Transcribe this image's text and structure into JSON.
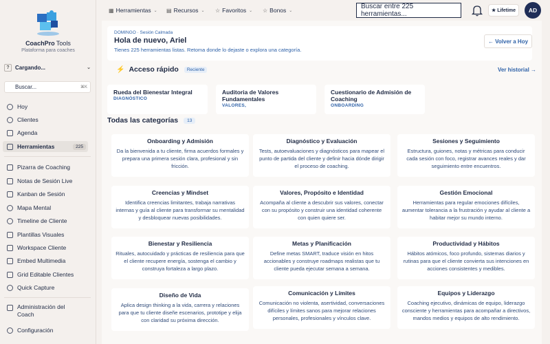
{
  "brand": {
    "name_bold": "CoachPro",
    "name_light": " Tools",
    "tagline": "Plataforma para coaches"
  },
  "account": {
    "avatar_letter": "?",
    "label": "Cargando..."
  },
  "sidebar_search": {
    "placeholder": "Buscar...",
    "shortcut": "⌘K"
  },
  "sidebar": {
    "primary": [
      {
        "label": "Hoy",
        "icon": "sun-icon"
      },
      {
        "label": "Clientes",
        "icon": "users-icon"
      },
      {
        "label": "Agenda",
        "icon": "calendar-icon"
      },
      {
        "label": "Herramientas",
        "icon": "grid-icon",
        "count": "225",
        "active": true
      }
    ],
    "tools": [
      {
        "label": "Pizarra de Coaching",
        "icon": "whiteboard-icon"
      },
      {
        "label": "Notas de Sesión Live",
        "icon": "notes-icon"
      },
      {
        "label": "Kanban de Sesión",
        "icon": "kanban-icon"
      },
      {
        "label": "Mapa Mental",
        "icon": "mindmap-icon"
      },
      {
        "label": "Timeline de Cliente",
        "icon": "timeline-icon"
      },
      {
        "label": "Plantillas Visuales",
        "icon": "template-icon"
      },
      {
        "label": "Workspace Cliente",
        "icon": "workspace-icon"
      },
      {
        "label": "Embed Multimedia",
        "icon": "video-icon"
      },
      {
        "label": "Grid Editable Clientes",
        "icon": "table-icon"
      },
      {
        "label": "Quick Capture",
        "icon": "lightning-icon"
      }
    ],
    "bottom": [
      {
        "label": "Administración del Coach",
        "icon": "shield-icon"
      },
      {
        "label": "Configuración",
        "icon": "gear-icon"
      }
    ]
  },
  "topbar": {
    "menus": [
      {
        "label": "Herramientas",
        "icon": "grid-icon"
      },
      {
        "label": "Recursos",
        "icon": "book-icon"
      },
      {
        "label": "Favoritos",
        "icon": "star-icon"
      },
      {
        "label": "Bonos",
        "icon": "gift-icon"
      }
    ],
    "search_placeholder": "Buscar entre 225 herramientas...",
    "lifetime_label": "★ Lifetime",
    "avatar_initials": "AD"
  },
  "hero": {
    "kicker": "DOMINGO · Sesión Calmada",
    "greeting": "Hola de nuevo, Ariel",
    "subtitle": "Tienes 225 herramientas listas. Retoma donde lo dejaste o explora una categoría.",
    "back_button": "← Volver a Hoy"
  },
  "quick_access": {
    "title": "Acceso rápido",
    "badge": "Reciente",
    "history_link": "Ver historial →",
    "cards": [
      {
        "title": "Rueda del Bienestar Integral",
        "category": "DIAGNÓSTICO"
      },
      {
        "title": "Auditoria de Valores Fundamentales",
        "category": "VALORES,"
      },
      {
        "title": "Cuestionario de Admisión de Coaching",
        "category": "ONBOARDING"
      }
    ]
  },
  "categories": {
    "title": "Todas las categorías",
    "count": "13",
    "items": [
      {
        "title": "Onboarding y Admisión",
        "desc": "Da la bienvenida a tu cliente, firma acuerdos formales y prepara una primera sesión clara, profesional y sin fricción."
      },
      {
        "title": "Diagnóstico y Evaluación",
        "desc": "Tests, autoevaluaciones y diagnósticos para mapear el punto de partida del cliente y definir hacia dónde dirigir el proceso de coaching."
      },
      {
        "title": "Sesiones y Seguimiento",
        "desc": "Estructura, guiones, notas y métricas para conducir cada sesión con foco, registrar avances reales y dar seguimiento entre encuentros."
      },
      {
        "title": "Creencias y Mindset",
        "desc": "Identifica creencias limitantes, trabaja narrativas internas y guía al cliente para transformar su mentalidad y desbloquear nuevas posibilidades."
      },
      {
        "title": "Valores, Propósito e Identidad",
        "desc": "Acompaña al cliente a descubrir sus valores, conectar con su propósito y construir una identidad coherente con quien quiere ser."
      },
      {
        "title": "Gestión Emocional",
        "desc": "Herramientas para regular emociones difíciles, aumentar tolerancia a la frustración y ayudar al cliente a habitar mejor su mundo interno."
      },
      {
        "title": "Bienestar y Resiliencia",
        "desc": "Rituales, autocuidado y prácticas de resiliencia para que el cliente recupere energía, sostenga el cambio y construya fortaleza a largo plazo."
      },
      {
        "title": "Metas y Planificación",
        "desc": "Define metas SMART, traduce visión en hitos accionables y construye roadmaps realistas que tu cliente pueda ejecutar semana a semana."
      },
      {
        "title": "Productividad y Hábitos",
        "desc": "Hábitos atómicos, foco profundo, sistemas diarios y rutinas para que el cliente convierta sus intenciones en acciones consistentes y medibles."
      },
      {
        "title": "Diseño de Vida",
        "desc": "Aplica design thinking a la vida, carrera y relaciones para que tu cliente diseñe escenarios, prototipe y elija con claridad su próxima dirección."
      },
      {
        "title": "Comunicación y Límites",
        "desc": "Comunicación no violenta, asertividad, conversaciones difíciles y límites sanos para mejorar relaciones personales, profesionales y vínculos clave."
      },
      {
        "title": "Equipos y Liderazgo",
        "desc": "Coaching ejecutivo, dinámicas de equipo, liderazgo consciente y herramientas para acompañar a directivos, mandos medios y equipos de alto rendimiento."
      }
    ]
  },
  "colors": {
    "accent": "#2f62a8",
    "navy": "#1f2a44",
    "avatar_bg": "#1f2d57",
    "page_bg": "#f5f1ee"
  }
}
